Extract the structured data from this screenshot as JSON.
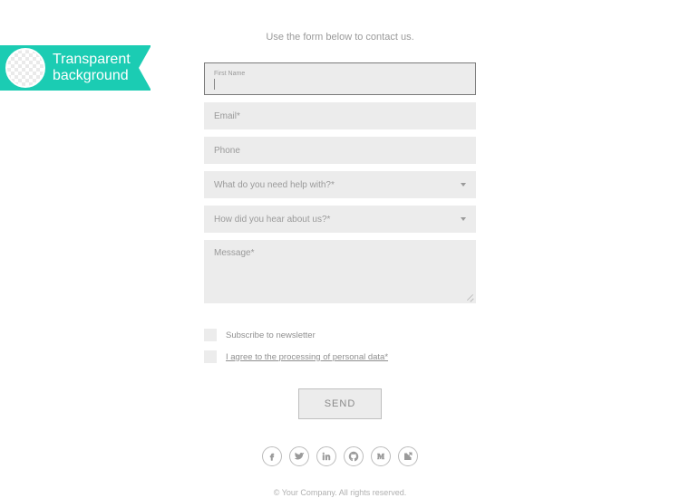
{
  "badge": {
    "line1": "Transparent",
    "line2": "background"
  },
  "intro": "Use the form below to contact us.",
  "form": {
    "first_name": {
      "label": "First Name",
      "value": ""
    },
    "email": {
      "placeholder": "Email*"
    },
    "phone": {
      "placeholder": "Phone"
    },
    "help": {
      "placeholder": "What do you need help with?*"
    },
    "hear": {
      "placeholder": "How did you hear about us?*"
    },
    "message": {
      "placeholder": "Message*"
    }
  },
  "checks": {
    "newsletter": "Subscribe to newsletter",
    "privacy": "I agree to the processing of personal data*"
  },
  "actions": {
    "send": "SEND"
  },
  "socials": {
    "items": [
      "facebook",
      "twitter",
      "linkedin",
      "github",
      "medium",
      "share"
    ]
  },
  "copyright": "© Your Company. All rights reserved."
}
